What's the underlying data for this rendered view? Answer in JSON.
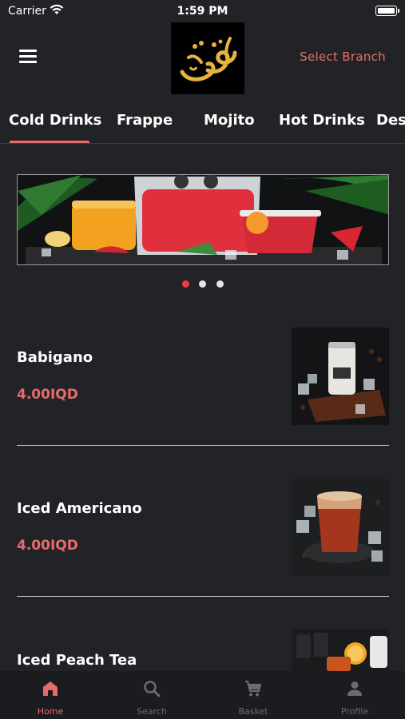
{
  "status_bar": {
    "carrier": "Carrier",
    "time": "1:59 PM"
  },
  "header": {
    "select_branch": "Select Branch"
  },
  "tabs": [
    {
      "label": "Cold Drinks",
      "active": true
    },
    {
      "label": "Frappe"
    },
    {
      "label": "Mojito"
    },
    {
      "label": "Hot Drinks"
    },
    {
      "label": "Des"
    }
  ],
  "carousel": {
    "pages": 3,
    "active_page": 1
  },
  "products": [
    {
      "name": "Babigano",
      "price": "4.00IQD"
    },
    {
      "name": "Iced Americano",
      "price": "4.00IQD"
    },
    {
      "name": "Iced Peach Tea",
      "price": ""
    }
  ],
  "bottom_nav": [
    {
      "label": "Home",
      "icon": "home-icon",
      "active": true
    },
    {
      "label": "Search",
      "icon": "search-icon"
    },
    {
      "label": "Basket",
      "icon": "cart-icon"
    },
    {
      "label": "Profile",
      "icon": "person-icon"
    }
  ],
  "colors": {
    "accent": "#e86a6a",
    "background": "#222326",
    "active_dot": "#f03b4e"
  }
}
